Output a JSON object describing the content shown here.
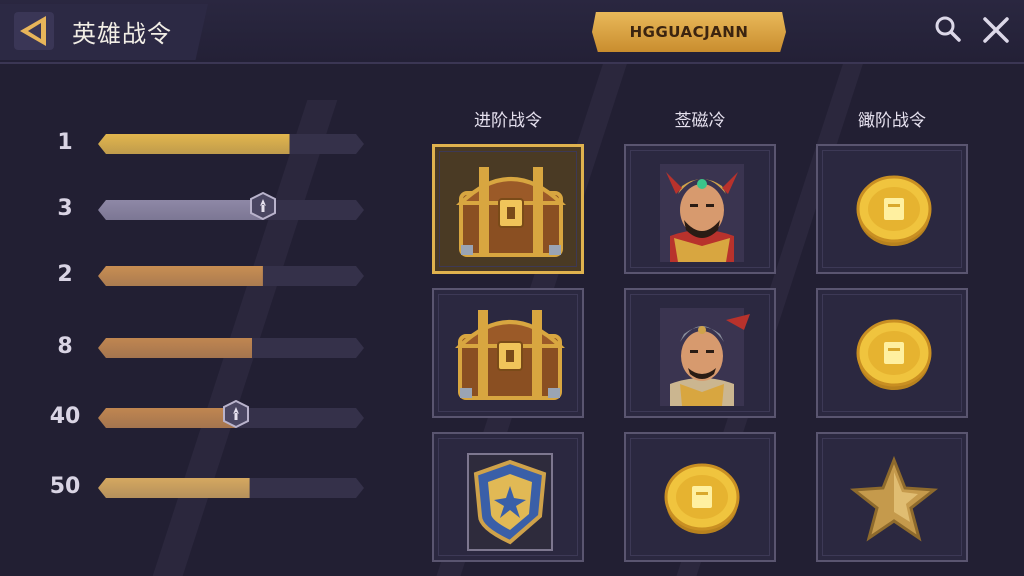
{
  "header": {
    "title": "英雄战令",
    "banner_label": "HGGUACJANN"
  },
  "levels": [
    {
      "label": "1",
      "fill": 0.72,
      "color": "#e2b64d",
      "badge": false
    },
    {
      "label": "3",
      "fill": 0.62,
      "color": "#8e88a6",
      "badge": true
    },
    {
      "label": "2",
      "fill": 0.62,
      "color": "#c88e52",
      "badge": false
    },
    {
      "label": "8",
      "fill": 0.58,
      "color": "#c08650",
      "badge": false
    },
    {
      "label": "40",
      "fill": 0.52,
      "color": "#c08650",
      "badge": true
    },
    {
      "label": "50",
      "fill": 0.57,
      "color": "#d5a860",
      "badge": false
    }
  ],
  "columns": [
    {
      "header": "进阶战令"
    },
    {
      "header": "莶磁冷"
    },
    {
      "header": "豃阶战令"
    }
  ],
  "rewards": [
    [
      "treasure-chest",
      "hero-portrait-warlord",
      "gold-coin"
    ],
    [
      "treasure-chest",
      "hero-portrait-general",
      "gold-coin"
    ],
    [
      "shield-emblem",
      "gold-coin",
      "bronze-star"
    ]
  ],
  "colors": {
    "accent_gold": "#e0b24e",
    "background": "#221f33"
  }
}
